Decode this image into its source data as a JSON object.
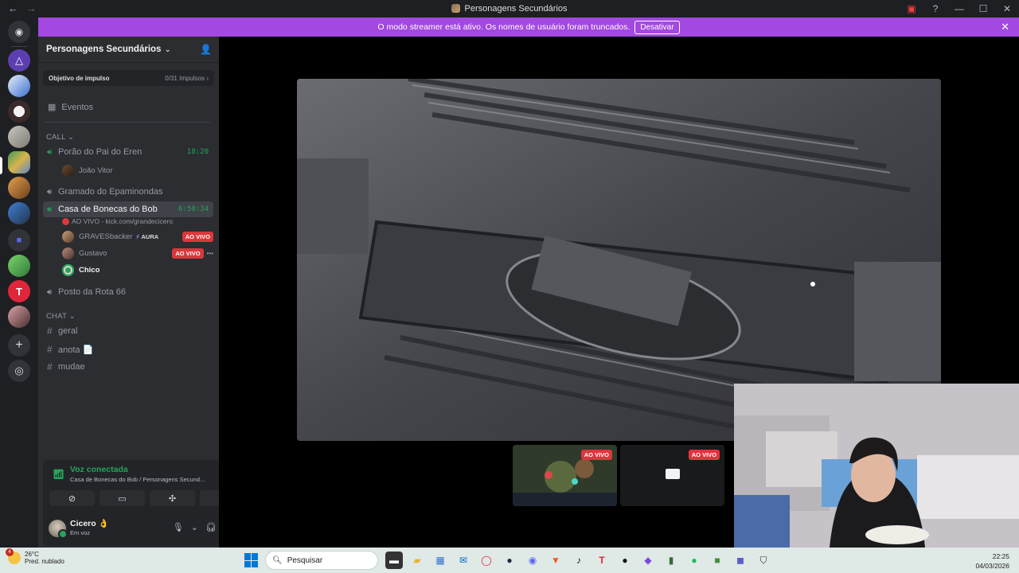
{
  "window": {
    "title": "Personagens Secundários",
    "back": "←",
    "forward": "→",
    "controls": {
      "screen": "▣",
      "help": "?",
      "minimize": "—",
      "maximize": "☐",
      "close": "✕"
    }
  },
  "banner": {
    "text": "O modo streamer está ativo. Os nomes de usuário foram truncados.",
    "button": "Desativar",
    "close": "✕"
  },
  "server": {
    "name": "Personagens Secundários",
    "boost_label": "Objetivo de impulso",
    "boost_value": "0/31 Impulsos ›",
    "events": "Eventos"
  },
  "categories": {
    "call": "CALL ⌄",
    "chat": "CHAT ⌄"
  },
  "voice_channels": [
    {
      "name": "Porão do Pai do Eren",
      "time": "18:20"
    },
    {
      "name": "Gramado do Epaminondas",
      "time": ""
    },
    {
      "name": "Casa de Bonecas do Bob",
      "time": "6:50:34",
      "sub": "AO VIVO - kick.com/grandecicero"
    },
    {
      "name": "Posto da Rota 66",
      "time": ""
    }
  ],
  "voice_users": {
    "porao": [
      {
        "name": "João Vitor"
      }
    ],
    "casa": [
      {
        "name": "GRAVESbacker",
        "tag": "AURA",
        "live": "AO VIVO"
      },
      {
        "name": "Gustavo",
        "live": "AO VIVO",
        "extra": "•••"
      },
      {
        "name": "Chico"
      }
    ]
  },
  "text_channels": [
    {
      "name": "geral"
    },
    {
      "name": "anota 📄"
    },
    {
      "name": "mudae"
    }
  ],
  "voice_panel": {
    "status": "Voz conectada",
    "detail": "Casa de Bonecas do Bob / Personagens Secund...",
    "user_name": "Cicero 👌",
    "user_status": "Em voz"
  },
  "stage": {
    "thumb_live_1": "AO VIVO",
    "thumb_live_2": "AO VIVO"
  },
  "taskbar": {
    "weather_temp": "26°C",
    "weather_desc": "Pred. nublado",
    "weather_badge": "4",
    "search_placeholder": "Pesquisar",
    "time": "22:25",
    "date": "04/03/2026"
  },
  "colors": {
    "accent": "#a348e0",
    "online": "#23a55a",
    "live": "#da373c",
    "sidebar": "#2b2d31"
  }
}
